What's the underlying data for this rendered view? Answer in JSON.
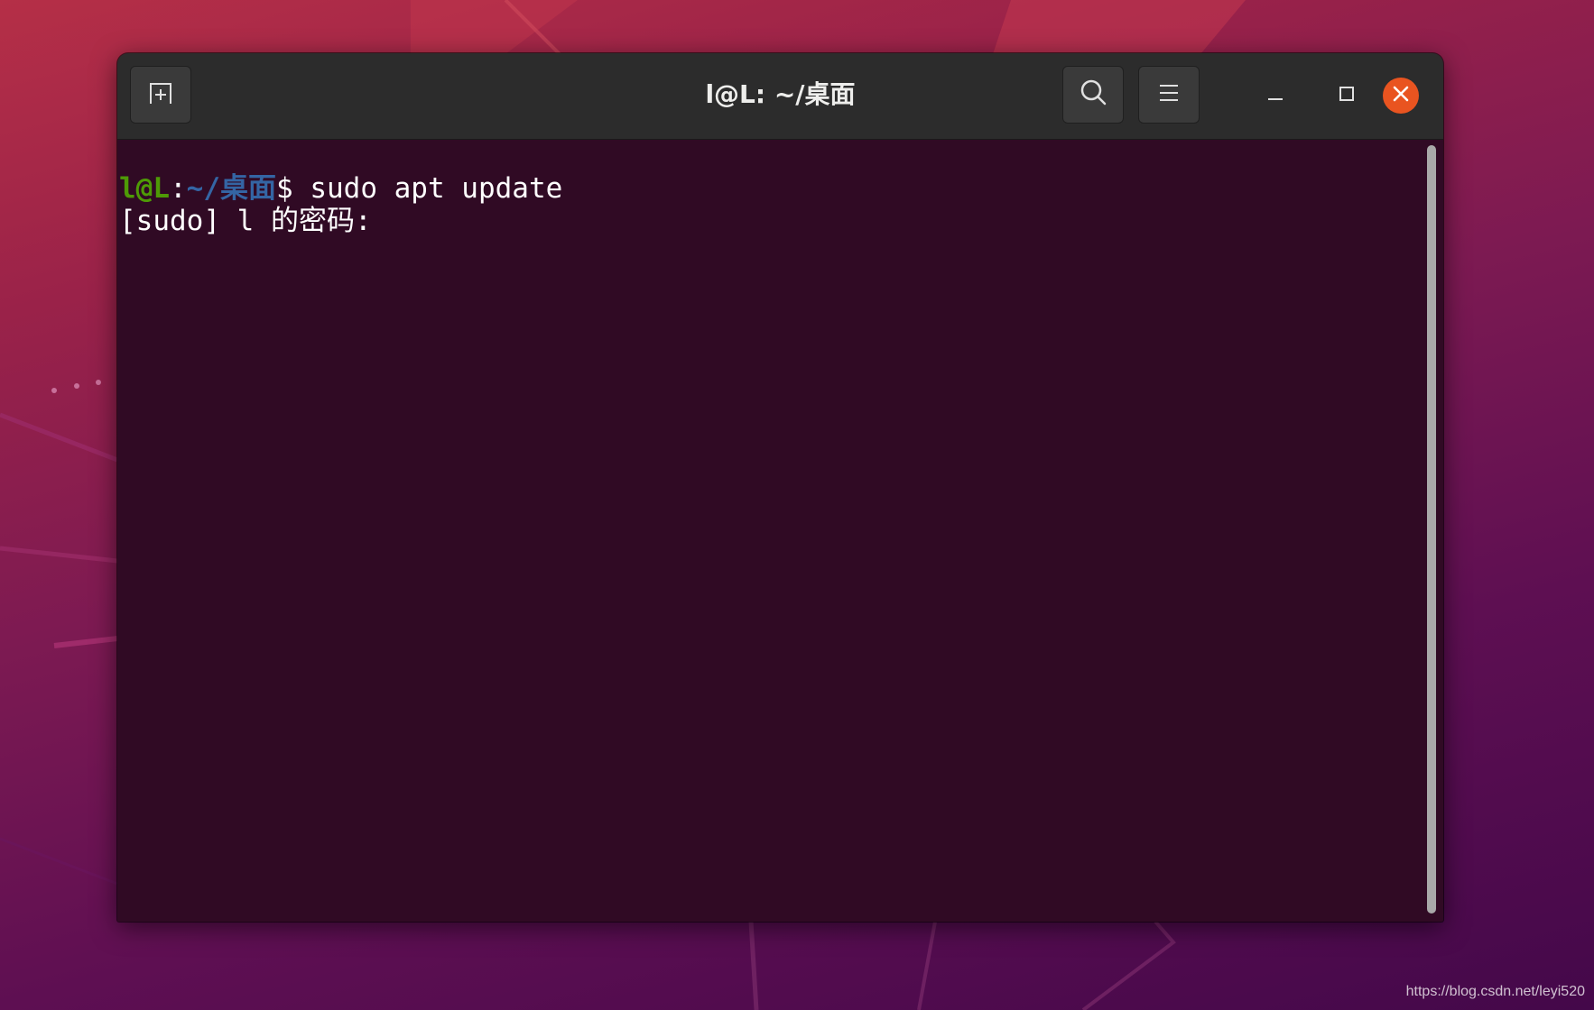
{
  "window": {
    "title": "l@L: ~/桌面"
  },
  "header": {
    "new_tab_icon": "new-tab-icon",
    "search_icon": "search-icon",
    "menu_icon": "hamburger-menu-icon",
    "minimize_icon": "minimize-icon",
    "maximize_icon": "maximize-icon",
    "close_icon": "close-icon"
  },
  "terminal": {
    "prompt_user_host": "l@L",
    "prompt_sep": ":",
    "prompt_path": "~/桌面",
    "prompt_symbol": "$ ",
    "command": "sudo apt update",
    "output_line": "[sudo] l 的密码: "
  },
  "colors": {
    "terminal_bg": "#300a24",
    "prompt_user": "#4e9a06",
    "prompt_path": "#3465a4",
    "close_button": "#e95420",
    "titlebar": "#2c2c2c"
  },
  "watermark": "https://blog.csdn.net/leyi520"
}
